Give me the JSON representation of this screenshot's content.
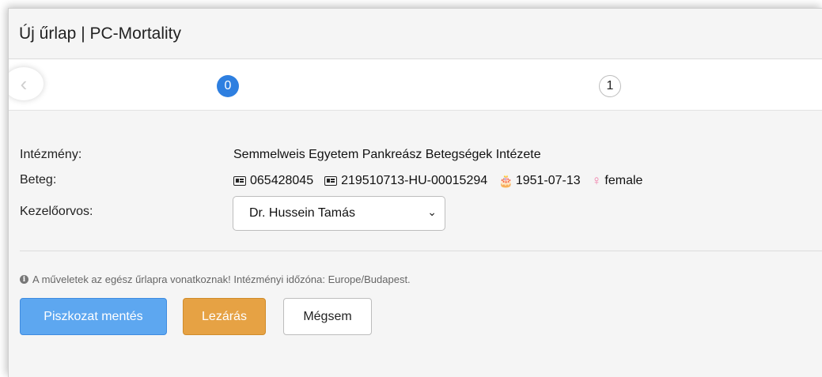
{
  "window": {
    "title": "Új űrlap | PC-Mortality"
  },
  "stepper": {
    "steps": [
      "0",
      "1"
    ],
    "active_index": 0,
    "back_glyph": "‹"
  },
  "form": {
    "institution_label": "Intézmény:",
    "institution_value": "Semmelweis Egyetem Pankreász Betegségek Intézete",
    "patient_label": "Beteg:",
    "patient_id1": "065428045",
    "patient_id2": "219510713-HU-00015294",
    "patient_birthdate": "1951-07-13",
    "patient_sex": "female",
    "physician_label": "Kezelőorvos:",
    "physician_selected": "Dr. Hussein Tamás"
  },
  "note": {
    "text": "A műveletek az egész űrlapra vonatkoznak! Intézményi időzóna: Europe/Budapest."
  },
  "buttons": {
    "draft": "Piszkozat mentés",
    "close": "Lezárás",
    "cancel": "Mégsem"
  },
  "colors": {
    "primary": "#2e7fe0",
    "draft": "#5da7f0",
    "warning": "#e6a244",
    "female": "#f07aa6"
  },
  "icons": {
    "id": "id-card-icon",
    "birthday": "birthday-cake-icon",
    "sex": "female-symbol-icon",
    "info": "info-circle-icon"
  }
}
